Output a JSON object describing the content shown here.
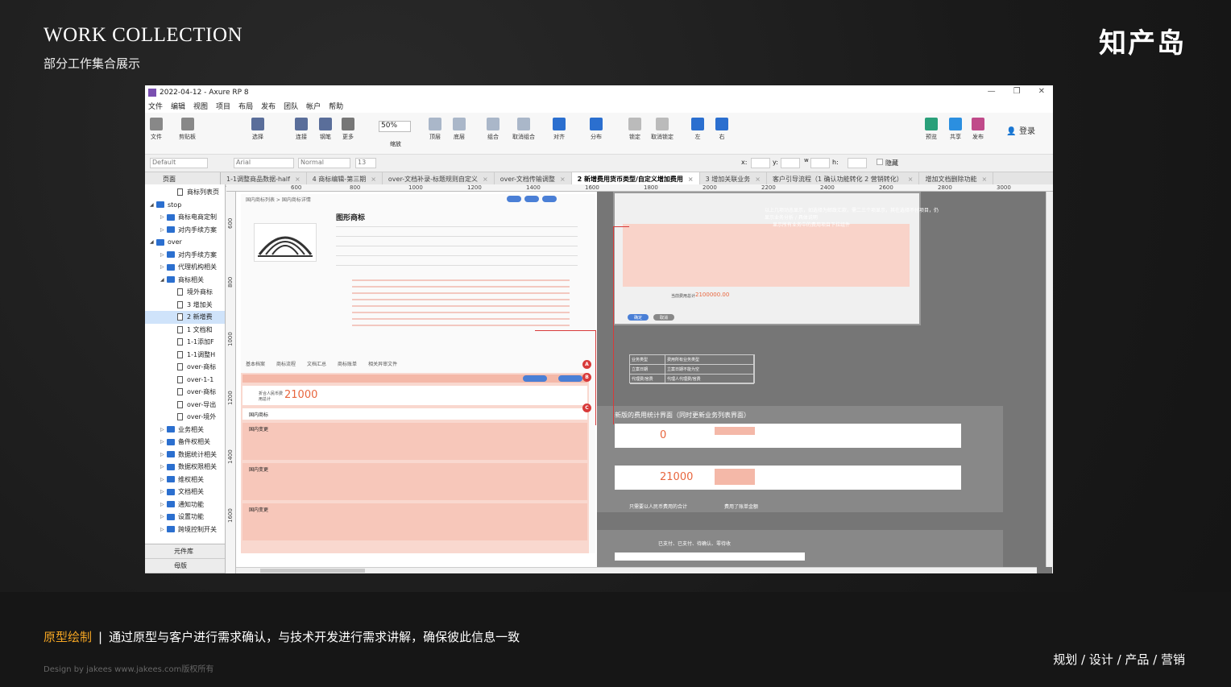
{
  "slide": {
    "title": "WORK COLLECTION",
    "subtitle": "部分工作集合展示",
    "logo": "知产岛",
    "caption_highlight": "原型绘制",
    "caption_sep": "|",
    "caption_text": "通过原型与客户进行需求确认，与技术开发进行需求讲解，确保彼此信息一致",
    "credit": "Design by jakees  www.jakees.com版权所有",
    "tags": "规划 / 设计 / 产品 / 营销"
  },
  "window": {
    "title": "2022-04-12 - Axure RP 8",
    "controls": [
      "—",
      "❐",
      "✕"
    ],
    "menu": [
      "文件",
      "编辑",
      "视图",
      "项目",
      "布局",
      "发布",
      "团队",
      "帐户",
      "帮助"
    ],
    "toolbar": {
      "items": [
        "文件",
        "剪贴板",
        "选择",
        "连接",
        "钢笔",
        "更多",
        "缩放",
        "顶层",
        "底层",
        "组合",
        "取消组合",
        "对齐",
        "分布",
        "锁定",
        "取消锁定",
        "左",
        "右",
        "预览",
        "共享",
        "发布"
      ],
      "zoom": "50%",
      "login": "登录"
    },
    "format": {
      "style": "Default",
      "font": "Arial",
      "weight": "Normal",
      "size": "13",
      "x_label": "x:",
      "y_label": "y:",
      "w_label": "w",
      "h_label": "h:",
      "hide_label": "隐藏"
    },
    "pages_label": "页面",
    "tabs": [
      {
        "label": "1-1调整商品数据-half",
        "active": false
      },
      {
        "label": "4 商标编辑-第三期",
        "active": false
      },
      {
        "label": "over-文档补录-标题规则自定义",
        "active": false
      },
      {
        "label": "over-文档传输调整",
        "active": false
      },
      {
        "label": "2 新增费用货币类型/自定义增加费用",
        "active": true
      },
      {
        "label": "3 增加关联业务",
        "active": false
      },
      {
        "label": "客户引导流程（1 确认功能转化 2 营销转化）",
        "active": false
      },
      {
        "label": "增加文档删除功能",
        "active": false
      }
    ],
    "tree": [
      {
        "label": "商标列表页",
        "type": "page",
        "indent": 2,
        "sel": false
      },
      {
        "label": "stop",
        "type": "folder",
        "indent": 0,
        "open": true,
        "sel": false
      },
      {
        "label": "商标电商定制",
        "type": "folder",
        "indent": 1,
        "sel": false
      },
      {
        "label": "对内手续方案",
        "type": "folder",
        "indent": 1,
        "sel": false
      },
      {
        "label": "over",
        "type": "folder",
        "indent": 0,
        "open": true,
        "sel": false
      },
      {
        "label": "对内手续方案",
        "type": "folder",
        "indent": 1,
        "sel": false
      },
      {
        "label": "代理机构相关",
        "type": "folder",
        "indent": 1,
        "sel": false
      },
      {
        "label": "商标相关",
        "type": "folder",
        "indent": 1,
        "open": true,
        "sel": false
      },
      {
        "label": "境外商标",
        "type": "page",
        "indent": 2,
        "sel": false
      },
      {
        "label": "3 增加关",
        "type": "page",
        "indent": 2,
        "sel": false
      },
      {
        "label": "2 新增费",
        "type": "page",
        "indent": 2,
        "sel": true
      },
      {
        "label": "1 文档和",
        "type": "page",
        "indent": 2,
        "sel": false
      },
      {
        "label": "1-1添加F",
        "type": "page",
        "indent": 2,
        "sel": false
      },
      {
        "label": "1-1调整H",
        "type": "page",
        "indent": 2,
        "sel": false
      },
      {
        "label": "over-商标",
        "type": "page",
        "indent": 2,
        "sel": false
      },
      {
        "label": "over-1-1",
        "type": "page",
        "indent": 2,
        "sel": false
      },
      {
        "label": "over-商标",
        "type": "page",
        "indent": 2,
        "sel": false
      },
      {
        "label": "over-导出",
        "type": "page",
        "indent": 2,
        "sel": false
      },
      {
        "label": "over-境外",
        "type": "page",
        "indent": 2,
        "sel": false
      },
      {
        "label": "业务相关",
        "type": "folder",
        "indent": 1,
        "sel": false
      },
      {
        "label": "备件权相关",
        "type": "folder",
        "indent": 1,
        "sel": false
      },
      {
        "label": "数据统计相关",
        "type": "folder",
        "indent": 1,
        "sel": false
      },
      {
        "label": "数据权限相关",
        "type": "folder",
        "indent": 1,
        "sel": false
      },
      {
        "label": "维权相关",
        "type": "folder",
        "indent": 1,
        "sel": false
      },
      {
        "label": "文档相关",
        "type": "folder",
        "indent": 1,
        "sel": false
      },
      {
        "label": "通知功能",
        "type": "folder",
        "indent": 1,
        "sel": false
      },
      {
        "label": "设置功能",
        "type": "folder",
        "indent": 1,
        "sel": false
      },
      {
        "label": "跨境控制开关",
        "type": "folder",
        "indent": 1,
        "sel": false
      }
    ],
    "side_footer": [
      "元件库",
      "母版"
    ]
  },
  "canvas": {
    "ruler_h": [
      "600",
      "800",
      "1000",
      "1200",
      "1400",
      "1600",
      "1800",
      "2000",
      "2200",
      "2400",
      "2600",
      "2800",
      "3000"
    ],
    "ruler_v": [
      "600",
      "800",
      "1000",
      "1200",
      "1400",
      "1600"
    ],
    "left": {
      "breadcrumb": "国内商标列表 > 国内商标详情",
      "title": "图形商标",
      "total_label": "折合人民币费用总计",
      "total_amount": "21000",
      "tabs": [
        "基本档案",
        "商标流程",
        "文档汇总",
        "商标账单",
        "相关异审文件"
      ],
      "sections": [
        "国内商标",
        "国内变更",
        "国内变更",
        "国内变更"
      ],
      "markers": [
        "A",
        "B",
        "C"
      ]
    },
    "right": {
      "note1": "以上几项动态显示，如选择为邮政汇款，需二三个项显示，其在选择不付项目，仍显示业务分析 / 具体说明",
      "note2": "显示所有业务中的费用项目下拉组件",
      "sum_label": "当前费用总计",
      "sum_amount": "2100000.00",
      "btn_ok": "确定",
      "btn_cancel": "取消",
      "panel2_title": "新版的费用统计界面（同时更新业务列表界面）",
      "zero_amount": "0",
      "total_amount": "21000",
      "note3": "只需要以人民币费用的合计",
      "note4": "费用了账单金额",
      "table_rows": [
        [
          "业务类型",
          "费用所有业务类型"
        ],
        [
          "立案日期",
          "立案日期不能为空"
        ],
        [
          "代理费/官费",
          "代理人代理费/官费"
        ]
      ],
      "panel3_title": "已支付、已支付、待确认、零待收"
    }
  }
}
